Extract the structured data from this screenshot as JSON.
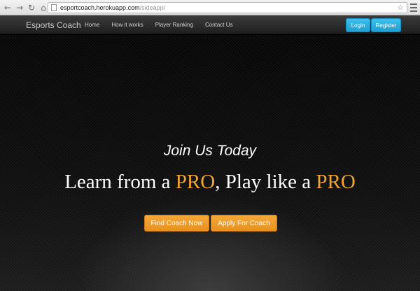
{
  "browser": {
    "url_host": "esportcoach.herokuapp.com",
    "url_path": "/sideapp/",
    "icons": [
      "back-arrow-icon",
      "forward-arrow-icon",
      "reload-icon",
      "home-icon",
      "page-icon",
      "bookmark-star-icon",
      "menu-icon"
    ]
  },
  "navbar": {
    "brand": "Esports Coach",
    "links": [
      "Home",
      "How it works",
      "Player Ranking",
      "Contact Us"
    ],
    "login_label": "Login",
    "register_label": "Register"
  },
  "hero": {
    "subtitle": "Join Us Today",
    "title_part1": "Learn from a ",
    "title_accent1": "PRO",
    "title_part2": ", Play like a ",
    "title_accent2": "PRO",
    "find_coach_label": "Find Coach Now",
    "apply_coach_label": "Apply For Coach"
  },
  "colors": {
    "accent_orange": "#f0a52f",
    "button_blue": "#2aaee0",
    "navbar_bg": "#2b2b2b"
  }
}
